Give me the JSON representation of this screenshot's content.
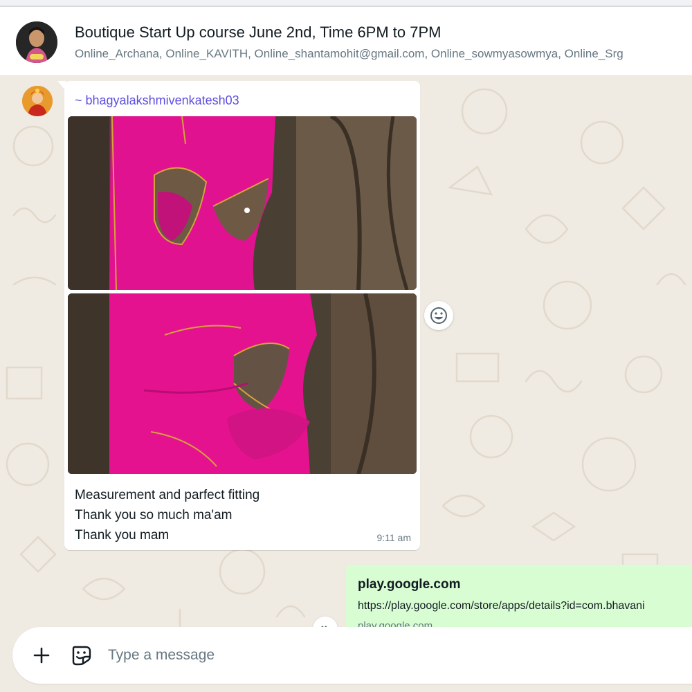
{
  "header": {
    "title": "Boutique Start Up course June 2nd, Time 6PM to 7PM",
    "members": "Online_Archana, Online_KAVITH, Online_shantamohit@gmail.com, Online_sowmyasowmya, Online_Srg",
    "avatar_icon": "group-avatar-photo"
  },
  "messages": {
    "incoming": {
      "sender": "~ bhagyalakshmivenkatesh03",
      "lines": [
        "Measurement and parfect fitting",
        "Thank you so much ma'am",
        "Thank you mam"
      ],
      "time": "9:11 am"
    },
    "outgoing": {
      "link_domain": "play.google.com",
      "link_url": "https://play.google.com/store/apps/details?id=com.bhavani",
      "link_sub": "play.google.com"
    }
  },
  "icons": {
    "react": "emoji-icon",
    "forward": "forward-icon",
    "attach": "plus-icon",
    "sticker": "sticker-icon"
  },
  "composer": {
    "placeholder": "Type a message"
  },
  "colors": {
    "sender_name": "#5e4ee0",
    "outgoing_bubble": "#d9fdd3",
    "chat_background": "#efeae2"
  }
}
